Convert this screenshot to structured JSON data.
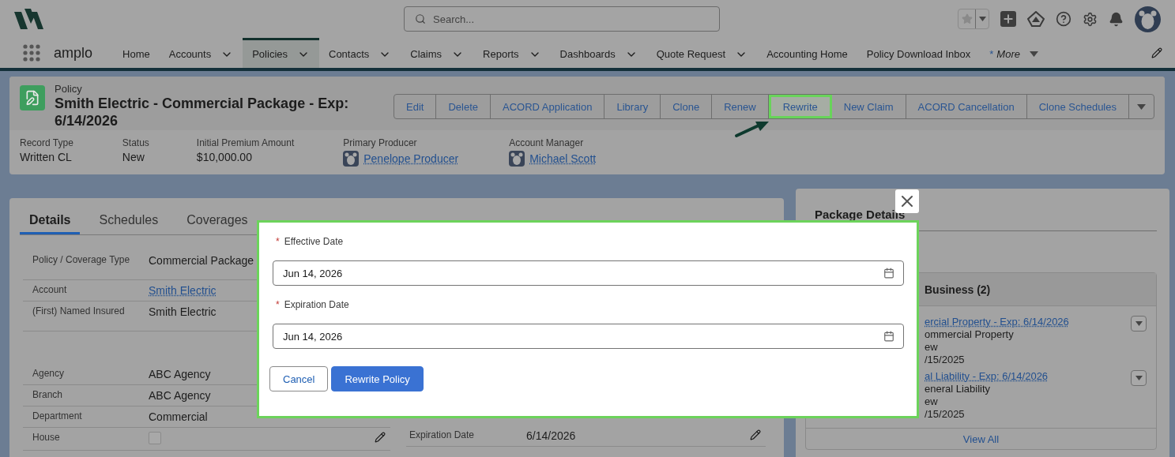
{
  "header": {
    "search": {
      "placeholder": "Search..."
    }
  },
  "nav": {
    "app_name": "amplo",
    "items": [
      {
        "label": "Home",
        "kind": "plain",
        "selected": false
      },
      {
        "label": "Accounts",
        "kind": "menu",
        "selected": false
      },
      {
        "label": "Policies",
        "kind": "menu",
        "selected": true
      },
      {
        "label": "Contacts",
        "kind": "menu",
        "selected": false
      },
      {
        "label": "Claims",
        "kind": "menu",
        "selected": false
      },
      {
        "label": "Reports",
        "kind": "menu",
        "selected": false
      },
      {
        "label": "Dashboards",
        "kind": "menu",
        "selected": false
      },
      {
        "label": "Quote Request",
        "kind": "menu",
        "selected": false
      },
      {
        "label": "Accounting Home",
        "kind": "plain",
        "selected": false
      },
      {
        "label": "Policy Download Inbox",
        "kind": "plain",
        "selected": false
      },
      {
        "label": "More",
        "marker": "*",
        "kind": "more",
        "selected": false
      }
    ]
  },
  "record": {
    "object": "Policy",
    "title": "Smith Electric - Commercial Package - Exp: 6/14/2026",
    "actions": [
      {
        "label": "Edit",
        "highlighted": false
      },
      {
        "label": "Delete",
        "highlighted": false
      },
      {
        "label": "ACORD Application",
        "highlighted": false
      },
      {
        "label": "Library",
        "highlighted": false
      },
      {
        "label": "Clone",
        "highlighted": false
      },
      {
        "label": "Renew",
        "highlighted": false
      },
      {
        "label": "Rewrite",
        "highlighted": true
      },
      {
        "label": "New Claim",
        "highlighted": false
      },
      {
        "label": "ACORD Cancellation",
        "highlighted": false
      },
      {
        "label": "Clone Schedules",
        "highlighted": false
      }
    ],
    "highlights": [
      {
        "label": "Record Type",
        "value": "Written CL",
        "kind": "text"
      },
      {
        "label": "Status",
        "value": "New",
        "kind": "text"
      },
      {
        "label": "Initial Premium Amount",
        "value": "$10,000.00",
        "kind": "text"
      },
      {
        "label": "Primary Producer",
        "value": "Penelope Producer",
        "kind": "user"
      },
      {
        "label": "Account Manager",
        "value": "Michael Scott",
        "kind": "user"
      }
    ]
  },
  "details": {
    "tabs": [
      {
        "label": "Details",
        "selected": true
      },
      {
        "label": "Schedules",
        "selected": false
      },
      {
        "label": "Coverages",
        "selected": false
      }
    ],
    "fields": [
      {
        "label": "Policy / Coverage Type",
        "value": "Commercial Package",
        "kind": "text"
      },
      {
        "label": "Account",
        "value": "Smith Electric",
        "kind": "link"
      },
      {
        "label": "(First) Named Insured",
        "value": "Smith Electric",
        "kind": "text"
      },
      {
        "kind": "blank"
      },
      {
        "label": "Agency",
        "value": "ABC Agency",
        "kind": "text"
      },
      {
        "label": "Branch",
        "value": "ABC Agency",
        "kind": "text"
      },
      {
        "label": "Department",
        "value": "Commercial",
        "kind": "text"
      },
      {
        "label": "House",
        "kind": "checkbox",
        "checked": false
      }
    ],
    "side_fields": [
      {
        "label": "Expiration Date",
        "value": "6/14/2026",
        "kind": "text"
      }
    ]
  },
  "package": {
    "title": "Package Details",
    "section": {
      "title": "Business (2)",
      "items": [
        {
          "link": "ercial Property - Exp: 6/14/2026",
          "lines": [
            "ommercial Property",
            "ew",
            "/15/2025"
          ]
        },
        {
          "link": "al Liability - Exp: 6/14/2026",
          "lines": [
            "eneral Liability",
            "ew",
            "/15/2025"
          ]
        }
      ],
      "footer": "View All"
    }
  },
  "modal": {
    "fields": [
      {
        "label": "Effective Date",
        "required": true,
        "value": "Jun 14, 2026"
      },
      {
        "label": "Expiration Date",
        "required": true,
        "value": "Jun 14, 2026"
      }
    ],
    "buttons": [
      {
        "label": "Cancel",
        "kind": "neutral"
      },
      {
        "label": "Rewrite Policy",
        "kind": "brand"
      }
    ]
  }
}
